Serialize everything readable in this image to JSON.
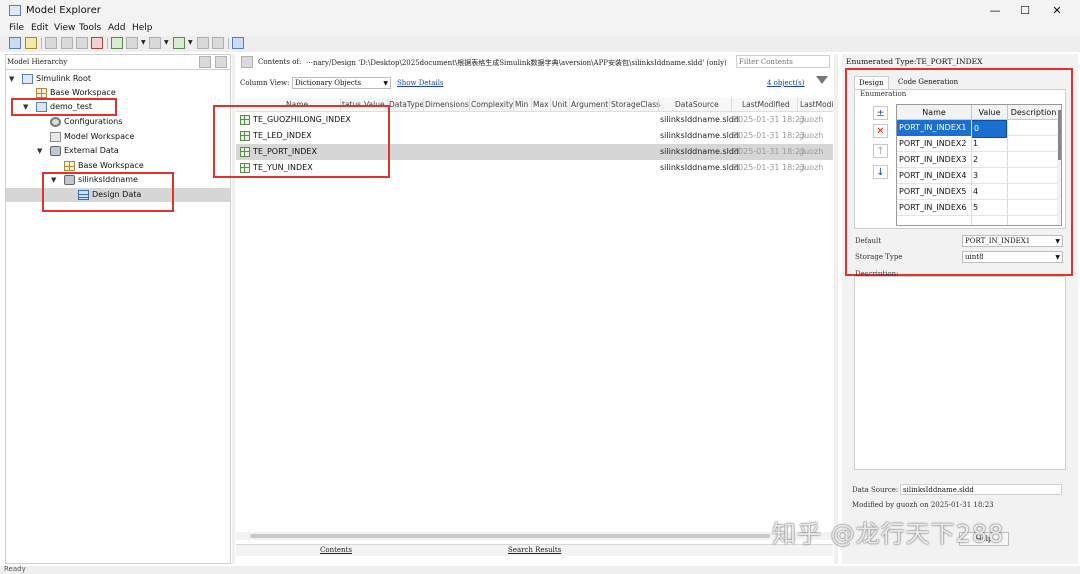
{
  "window": {
    "title": "Model Explorer",
    "minimize": "—",
    "maximize": "☐",
    "close": "✕"
  },
  "menu": [
    "File",
    "Edit",
    "View",
    "Tools",
    "Add",
    "Help"
  ],
  "left": {
    "header": "Model Hierarchy",
    "tree": [
      {
        "label": "Simulink Root",
        "icon": "simulink-root-icon"
      },
      {
        "label": "Base Workspace",
        "icon": "workspace-grid-icon"
      },
      {
        "label": "demo_test",
        "icon": "model-icon"
      },
      {
        "label": "Configurations",
        "icon": "gear-icon"
      },
      {
        "label": "Model Workspace",
        "icon": "workspace-icon"
      },
      {
        "label": "External Data",
        "icon": "external-data-icon"
      },
      {
        "label": "Base Workspace",
        "icon": "workspace-grid-icon"
      },
      {
        "label": "silinksIddname",
        "icon": "dictionary-icon"
      },
      {
        "label": "Design Data",
        "icon": "design-data-icon"
      }
    ]
  },
  "middle": {
    "contents_label": "Contents of:",
    "contents_path": "⋯nary/Design 'D:\\Desktop\\2025document\\根据表格生成Simulink数据字典\\aversion\\APP安装包\\silinksIddname.sldd' (only)",
    "filter_placeholder": "Filter Contents",
    "column_view_label": "Column View:",
    "column_view_value": "Dictionary Objects",
    "show_details": "Show Details",
    "object_count": "4 object(s)",
    "columns": [
      "Name",
      "tatus",
      "Value",
      "DataType",
      "Dimensions",
      "Complexity",
      "Min",
      "Max",
      "Unit",
      "Argument",
      "StorageClass",
      "DataSource",
      "LastModified",
      "LastModi"
    ],
    "rows": [
      {
        "name": "TE_GUOZHILONG_INDEX",
        "source": "silinksIddname.sldd",
        "modified": "2025-01-31 18:23",
        "by": "guozh"
      },
      {
        "name": "TE_LED_INDEX",
        "source": "silinksIddname.sldd",
        "modified": "2025-01-31 18:23",
        "by": "guozh"
      },
      {
        "name": "TE_PORT_INDEX",
        "source": "silinksIddname.sldd",
        "modified": "2025-01-31 18:23",
        "by": "guozh"
      },
      {
        "name": "TE_YUN_INDEX",
        "source": "silinksIddname.sldd",
        "modified": "2025-01-31 18:23",
        "by": "guozh"
      }
    ],
    "bottom_tabs": [
      "Contents",
      "Search Results"
    ]
  },
  "right": {
    "header": "Enumerated Type:TE_PORT_INDEX",
    "tabs": [
      "Design",
      "Code Generation"
    ],
    "group_label": "Enumeration",
    "enum_headers": [
      "Name",
      "Value",
      "Description"
    ],
    "enum_rows": [
      {
        "name": "PORT_IN_INDEX1",
        "value": "0"
      },
      {
        "name": "PORT_IN_INDEX2",
        "value": "1"
      },
      {
        "name": "PORT_IN_INDEX3",
        "value": "2"
      },
      {
        "name": "PORT_IN_INDEX4",
        "value": "3"
      },
      {
        "name": "PORT_IN_INDEX5",
        "value": "4"
      },
      {
        "name": "PORT_IN_INDEX6",
        "value": "5"
      }
    ],
    "default_label": "Default",
    "default_value": "PORT_IN_INDEX1",
    "storage_label": "Storage Type",
    "storage_value": "uint8",
    "description_label": "Description:",
    "datasource_label": "Data Source:",
    "datasource_value": "silinksIddname.sldd",
    "modified_text": "Modified by guozh on 2025-01-31 18:23",
    "help_button": "Help"
  },
  "status": {
    "left": "Ready"
  },
  "watermark": "知乎 @龙行天下288",
  "colors": {
    "highlight_red": "#e0332f",
    "selection_blue": "#1a6fd1",
    "selection_gray": "#d6d6d6"
  }
}
